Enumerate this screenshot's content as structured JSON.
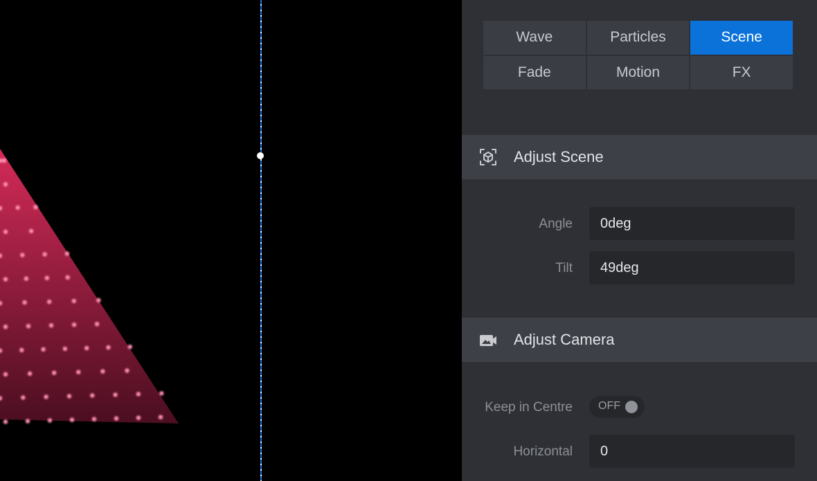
{
  "tabs": [
    {
      "label": "Wave",
      "active": false
    },
    {
      "label": "Particles",
      "active": false
    },
    {
      "label": "Scene",
      "active": true
    },
    {
      "label": "Fade",
      "active": false
    },
    {
      "label": "Motion",
      "active": false
    },
    {
      "label": "FX",
      "active": false
    }
  ],
  "adjust_scene": {
    "title": "Adjust Scene",
    "icon": "cube-focus-icon",
    "angle": {
      "label": "Angle",
      "value": "0deg"
    },
    "tilt": {
      "label": "Tilt",
      "value": "49deg"
    }
  },
  "adjust_camera": {
    "title": "Adjust Camera",
    "icon": "camera-icon",
    "keep_in_centre": {
      "label": "Keep in Centre",
      "state": "OFF"
    },
    "horizontal": {
      "label": "Horizontal",
      "value": "0"
    }
  },
  "colors": {
    "accent": "#0b72d9",
    "panel_bg": "#2e3035",
    "header_bg": "#3d4047",
    "particle_gradient_top": "#d42a58",
    "particle_gradient_bottom": "#4a0e20",
    "particle_dot": "#ff8fb0",
    "guide_line": "#1f6fd6"
  }
}
